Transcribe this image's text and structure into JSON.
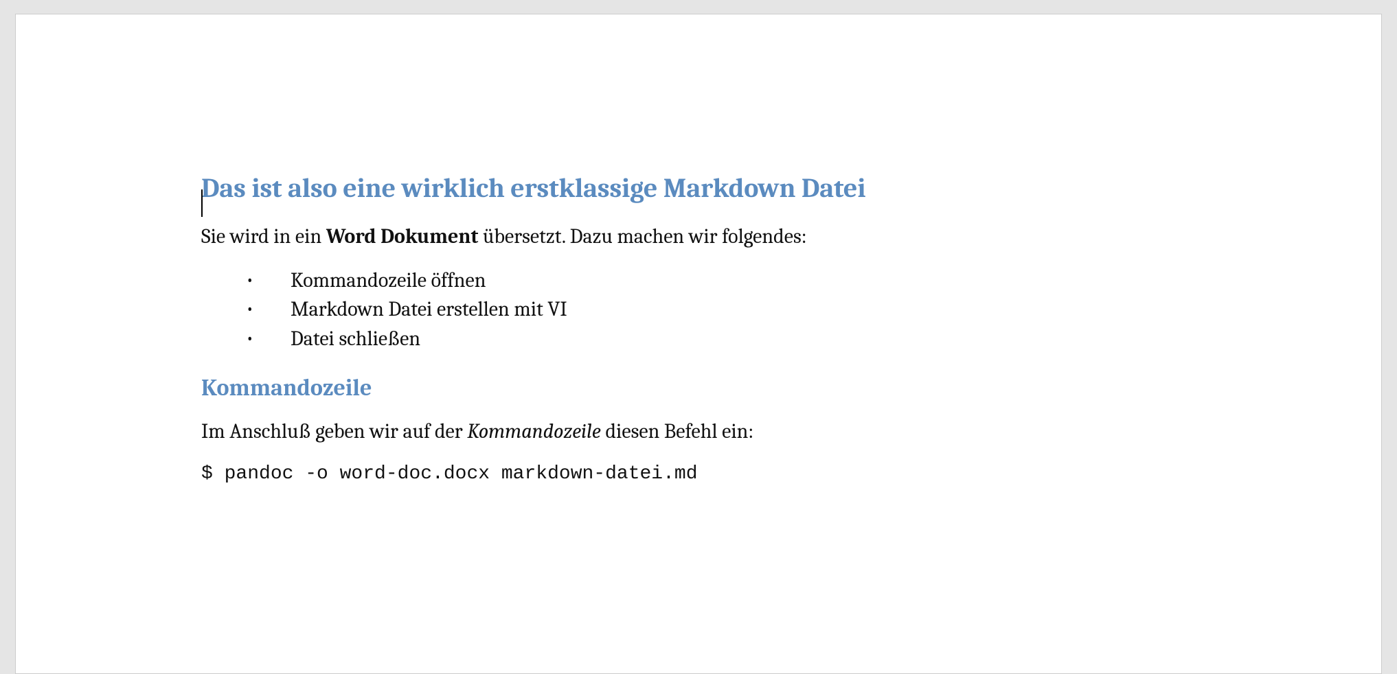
{
  "heading1": "Das ist also eine wirklich erstklassige Markdown Datei",
  "para1_pre": "Sie wird in ein ",
  "para1_bold": "Word Dokument",
  "para1_post": " übersetzt. Dazu machen wir folgendes:",
  "bullets": {
    "b0": "Kommandozeile öffnen",
    "b1": "Markdown Datei erstellen mit VI",
    "b2": "Datei schließen"
  },
  "heading2": "Kommandozeile",
  "para2_pre": "Im Anschluß geben wir auf der ",
  "para2_italic": "Kommandozeile",
  "para2_post": " diesen Befehl ein:",
  "code_line": "$ pandoc -o word-doc.docx markdown-datei.md"
}
